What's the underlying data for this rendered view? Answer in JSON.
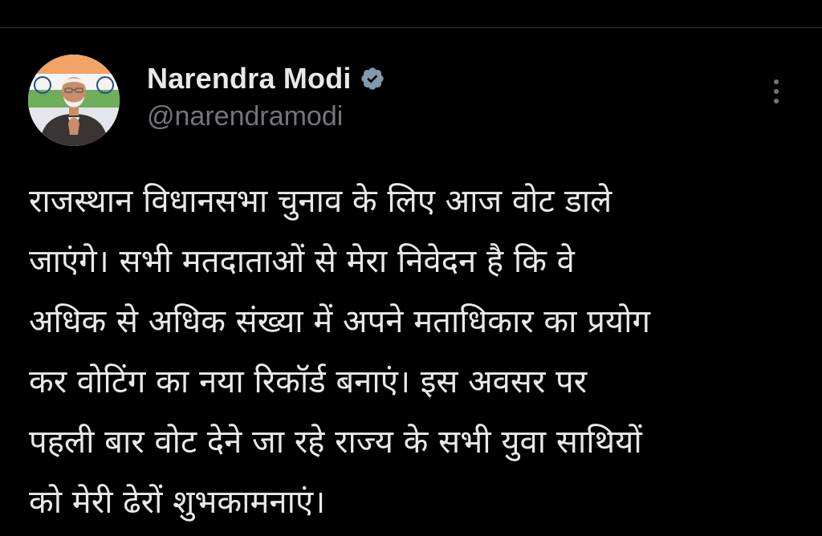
{
  "author": {
    "display_name": "Narendra Modi",
    "handle": "@narendramodi",
    "verified_icon": "verified-badge-icon",
    "avatar_icon": "profile-avatar"
  },
  "more_icon": "more-vertical-icon",
  "tweet": {
    "lines": [
      "राजस्थान विधानसभा चुनाव के लिए आज वोट डाले",
      "जाएंगे। सभी मतदाताओं से मेरा निवेदन है कि वे",
      "अधिक से अधिक संख्या में अपने मताधिकार का प्रयोग",
      "कर वोटिंग का नया रिकॉर्ड बनाएं। इस अवसर पर",
      "पहली बार वोट देने जा रहे राज्य के सभी युवा साथियों",
      "को मेरी ढेरों शुभकामनाएं।"
    ]
  },
  "colors": {
    "background": "#000000",
    "text_primary": "#e7e9ea",
    "text_secondary": "#71767b",
    "divider": "#2f3336",
    "verified": "#829aab"
  }
}
